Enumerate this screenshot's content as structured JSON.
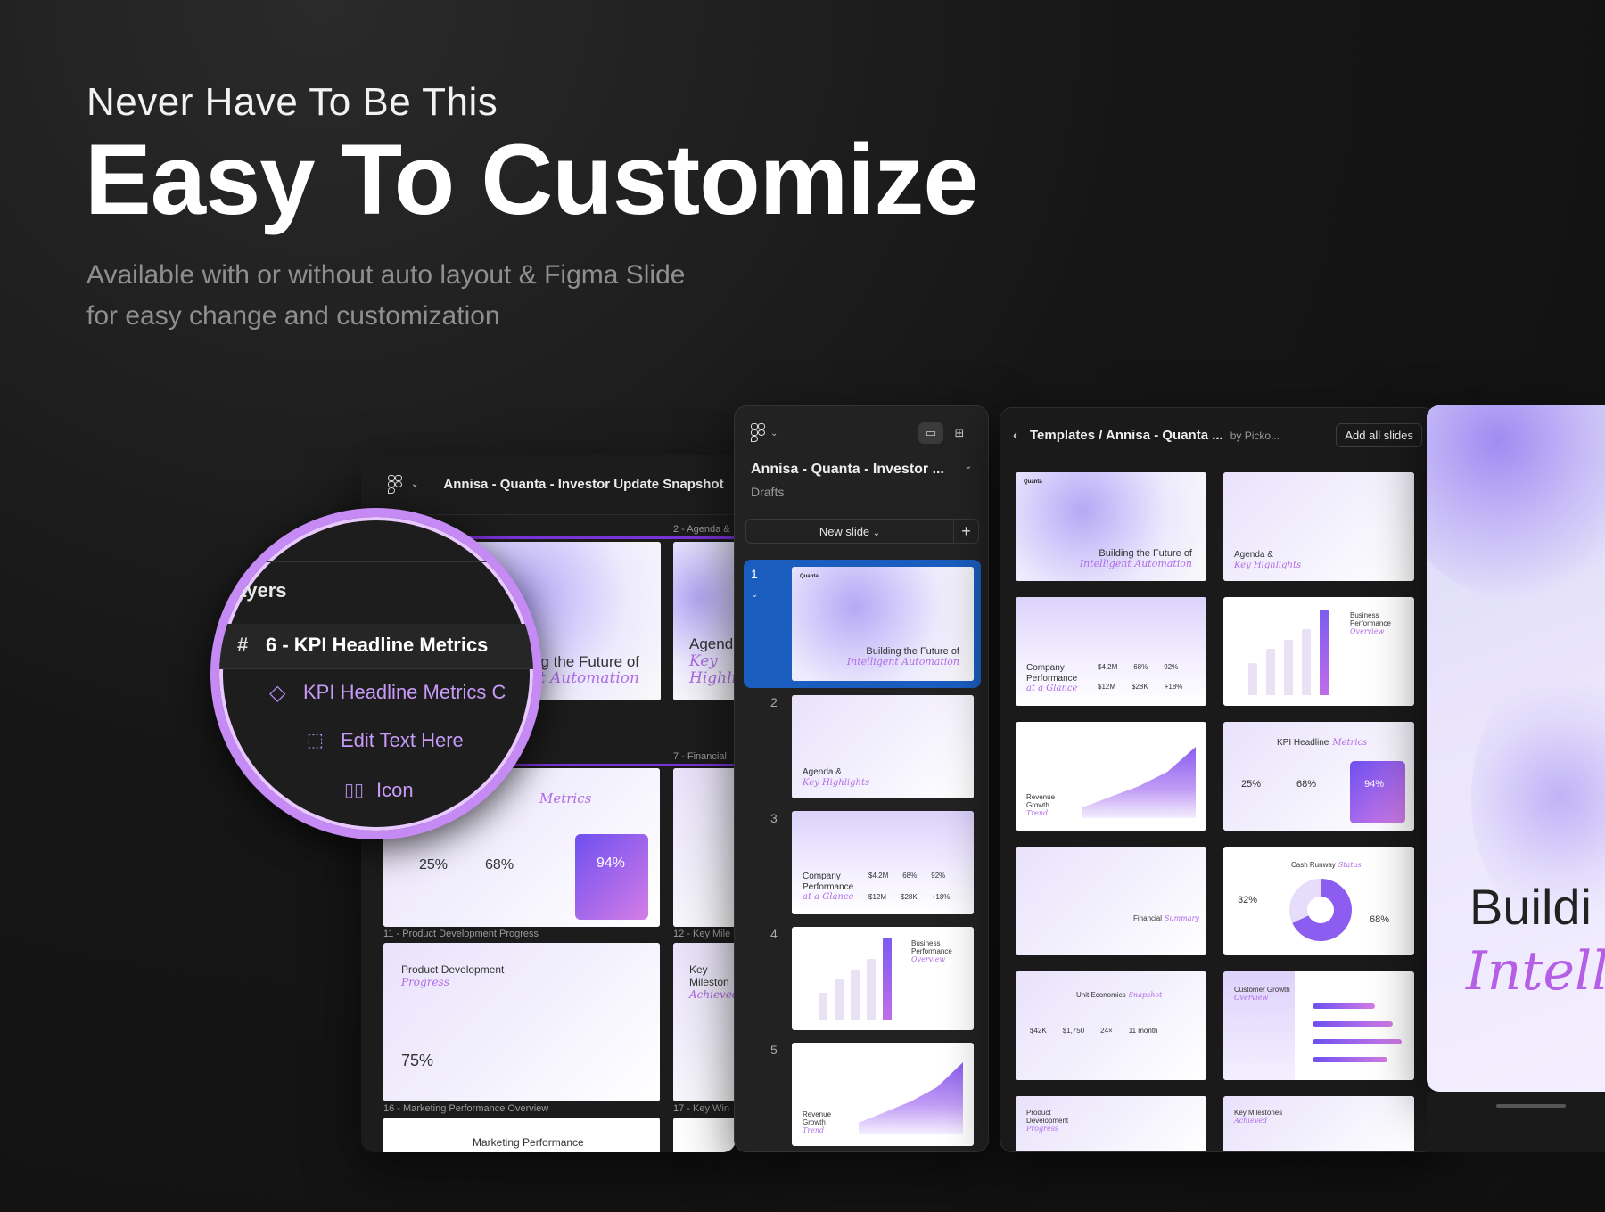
{
  "hero": {
    "eyebrow": "Never Have To Be This",
    "title": "Easy To Customize",
    "subtitle_line1": "Available with or without auto layout  & Figma Slide",
    "subtitle_line2": "for easy change and customization"
  },
  "window_a": {
    "title": "Annisa - Quanta - Investor Update Snapshot",
    "labels": [
      "2 - Agenda &",
      "7 - Financial",
      "11 - Product Development Progress",
      "12 - Key Mile",
      "16 - Marketing Performance Overview",
      "17 - Key Win"
    ]
  },
  "magnifier": {
    "layers_label": "ayers",
    "frame_name": "6 - KPI Headline Metrics",
    "component_name": "KPI Headline Metrics C",
    "text_layer": "Edit Text Here",
    "icon_layer": "Icon"
  },
  "panel_slides": {
    "file_title": "Annisa - Quanta - Investor ...",
    "location": "Drafts",
    "new_slide_label": "New slide",
    "slide_numbers": [
      "1",
      "2",
      "3",
      "4",
      "5"
    ]
  },
  "panel_templates": {
    "breadcrumb": "Templates / Annisa - Quanta ...",
    "author": "by Picko...",
    "add_all_label": "Add all slides"
  },
  "slide_text": {
    "logo": "Quanta",
    "hero_title": "Building the Future of",
    "hero_accent": "Intelligent Automation",
    "agenda_title": "Agenda &",
    "agenda_accent": "Key Highlights",
    "company_title": "Company Performance",
    "company_accent": "at a Glance",
    "stat_1": "$4.2M",
    "stat_2": "68%",
    "stat_3": "92%",
    "stat_4": "$12M",
    "stat_5": "$28K",
    "stat_6": "+18%",
    "business_title": "Business Performance",
    "business_accent": "Overview",
    "revenue_title": "Revenue Growth",
    "revenue_accent": "Trend",
    "kpi_title": "KPI Headline",
    "kpi_accent": "Metrics",
    "kpi_1": "25%",
    "kpi_2": "68%",
    "kpi_3": "94%",
    "financial_title": "Financial",
    "financial_accent": "Summary",
    "cash_title": "Cash Runway",
    "cash_accent": "Status",
    "cash_1": "32%",
    "cash_2": "68%",
    "unit_title": "Unit Economics",
    "unit_accent": "Snapshot",
    "unit_1": "$42K",
    "unit_2": "$1,750",
    "unit_3": "24×",
    "unit_4": "11 month",
    "customer_title": "Customer Growth",
    "customer_accent": "Overview",
    "product_title": "Product Development",
    "product_accent": "Progress",
    "product_stat": "75%",
    "milestones_title": "Key Milestones",
    "milestones_accent": "Achieved",
    "marketing_title": "Marketing Performance",
    "key_mile_short": "Key Mileston",
    "key_accent_short": "Achieved"
  },
  "preview": {
    "title_line1": "Buildi",
    "title_line2": "Intellig"
  },
  "colors": {
    "accent": "#c58af3",
    "selection": "#1b5dbf",
    "background": "#141414"
  }
}
